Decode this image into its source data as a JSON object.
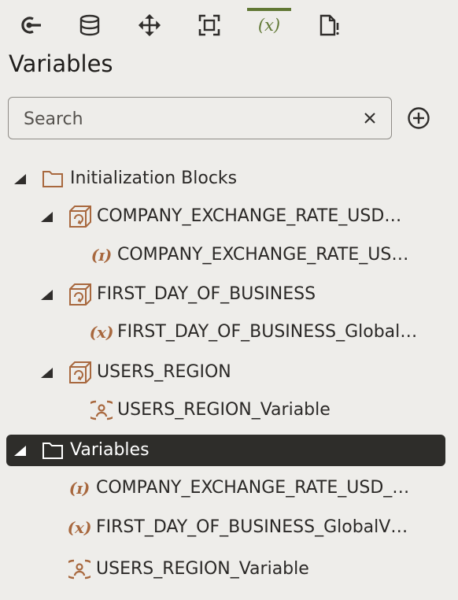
{
  "toolbar": {
    "items": [
      {
        "icon": "connection-icon"
      },
      {
        "icon": "database-icon"
      },
      {
        "icon": "move-icon"
      },
      {
        "icon": "focus-frame-icon"
      },
      {
        "icon": "variable-icon",
        "text": "(x)",
        "active": true
      },
      {
        "icon": "document-alert-icon"
      }
    ]
  },
  "panel": {
    "title": "Variables"
  },
  "search": {
    "placeholder": "Search",
    "value": ""
  },
  "tree": {
    "initialization_blocks": {
      "label": "Initialization Blocks",
      "children": [
        {
          "label": "COMPANY_EXCHANGE_RATE_USD…",
          "child": {
            "label": "COMPANY_EXCHANGE_RATE_US…",
            "icon_text": "(ɪ)"
          }
        },
        {
          "label": "FIRST_DAY_OF_BUSINESS",
          "child": {
            "label": "FIRST_DAY_OF_BUSINESS_Global…",
            "icon_text": "(x)"
          }
        },
        {
          "label": "USERS_REGION",
          "child": {
            "label": "USERS_REGION_Variable",
            "icon_text": "user"
          }
        }
      ]
    },
    "variables": {
      "label": "Variables",
      "items": [
        {
          "label": "COMPANY_EXCHANGE_RATE_USD_…",
          "icon_text": "(ɪ)"
        },
        {
          "label": "FIRST_DAY_OF_BUSINESS_GlobalV…",
          "icon_text": "(x)"
        },
        {
          "label": "USERS_REGION_Variable",
          "icon_text": "user"
        }
      ]
    }
  },
  "colors": {
    "accent": "#617835",
    "icon": "#a8683e",
    "selected_bg": "#2e2d2a",
    "background": "#eeedea"
  }
}
